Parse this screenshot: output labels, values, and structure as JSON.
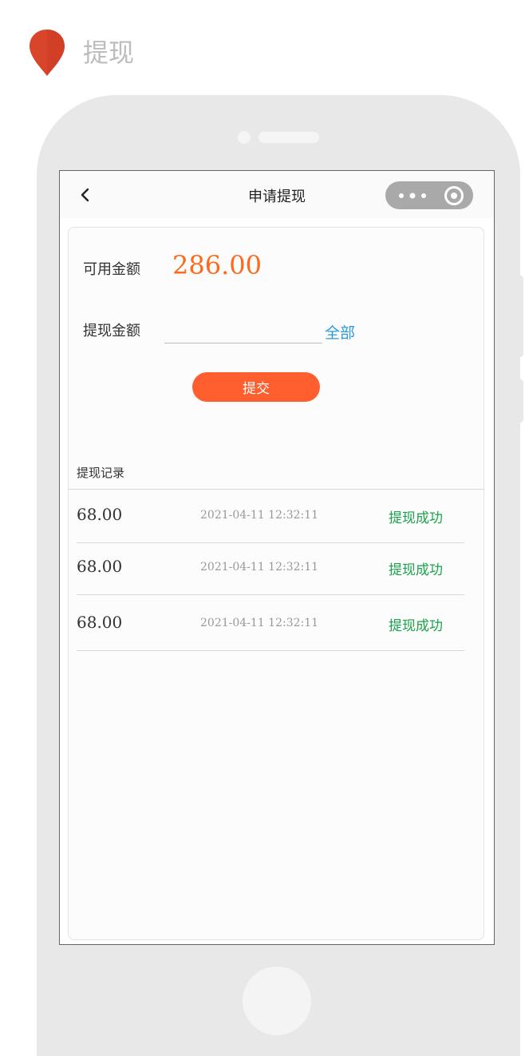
{
  "page_header": {
    "title": "提现"
  },
  "navbar": {
    "title": "申请提现"
  },
  "balance": {
    "label": "可用金额",
    "value": "286.00"
  },
  "withdraw": {
    "label": "提现金额",
    "value": "",
    "all_label": "全部",
    "submit_label": "提交"
  },
  "records": {
    "title": "提现记录",
    "items": [
      {
        "amount": "68.00",
        "time": "2021-04-11  12:32:11",
        "status": "提现成功"
      },
      {
        "amount": "68.00",
        "time": "2021-04-11  12:32:11",
        "status": "提现成功"
      },
      {
        "amount": "68.00",
        "time": "2021-04-11  12:32:11",
        "status": "提现成功"
      }
    ]
  },
  "colors": {
    "accent": "#ff5f2e",
    "balance": "#ff6a1a",
    "link": "#2a9bd8",
    "success": "#1aa34a",
    "pin": "#d9452b"
  },
  "icons": {
    "pin": "location-pin-icon",
    "back": "chevron-left-icon",
    "more": "more-dots-icon",
    "close": "target-circle-icon"
  }
}
